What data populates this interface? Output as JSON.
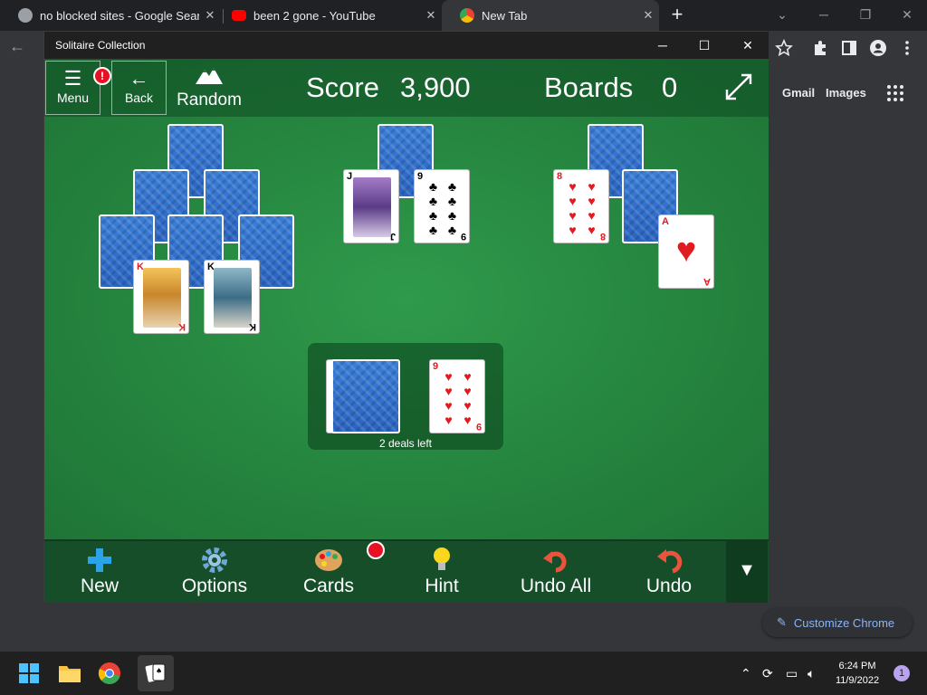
{
  "browser": {
    "tabs": [
      {
        "title": "no blocked sites - Google Search",
        "favicon": "globe-icon"
      },
      {
        "title": "been 2 gone - YouTube",
        "favicon": "youtube-icon"
      },
      {
        "title": "New Tab",
        "favicon": "chrome-icon",
        "active": true
      }
    ],
    "new_tab_label": "+",
    "links": {
      "gmail": "Gmail",
      "images": "Images"
    },
    "customize_label": "Customize Chrome"
  },
  "solitaire": {
    "window_title": "Solitaire Collection",
    "menu_label": "Menu",
    "menu_badge": "!",
    "back_label": "Back",
    "mode_label": "Random",
    "score_label": "Score",
    "score_value": "3,900",
    "boards_label": "Boards",
    "boards_value": "0",
    "deals_left": "2 deals left",
    "cards": {
      "pyr1_k1": "K",
      "pyr1_k2": "K",
      "pyr2_j": "J",
      "pyr2_9": "9",
      "pyr3_8": "8",
      "pyr3_a": "A",
      "waste_9": "9"
    },
    "commands": [
      {
        "label": "New",
        "icon": "plus-icon"
      },
      {
        "label": "Options",
        "icon": "gear-icon"
      },
      {
        "label": "Cards",
        "icon": "palette-icon"
      },
      {
        "label": "Hint",
        "icon": "lightbulb-icon"
      },
      {
        "label": "Undo All",
        "icon": "undo-all-icon"
      },
      {
        "label": "Undo",
        "icon": "undo-icon"
      }
    ]
  },
  "taskbar": {
    "time": "6:24 PM",
    "date": "11/9/2022",
    "notifications": "1"
  },
  "colors": {
    "felt": "#25853f",
    "accent_red": "#e81123",
    "chrome_link": "#8ab4f8"
  }
}
